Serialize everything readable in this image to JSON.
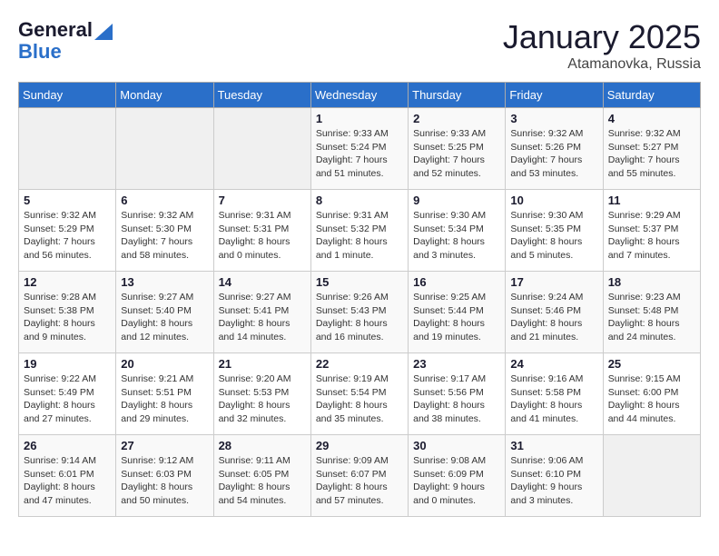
{
  "logo": {
    "general": "General",
    "blue": "Blue"
  },
  "header": {
    "month": "January 2025",
    "location": "Atamanovka, Russia"
  },
  "weekdays": [
    "Sunday",
    "Monday",
    "Tuesday",
    "Wednesday",
    "Thursday",
    "Friday",
    "Saturday"
  ],
  "weeks": [
    [
      {
        "day": "",
        "sunrise": "",
        "sunset": "",
        "daylight": ""
      },
      {
        "day": "",
        "sunrise": "",
        "sunset": "",
        "daylight": ""
      },
      {
        "day": "",
        "sunrise": "",
        "sunset": "",
        "daylight": ""
      },
      {
        "day": "1",
        "sunrise": "Sunrise: 9:33 AM",
        "sunset": "Sunset: 5:24 PM",
        "daylight": "Daylight: 7 hours and 51 minutes."
      },
      {
        "day": "2",
        "sunrise": "Sunrise: 9:33 AM",
        "sunset": "Sunset: 5:25 PM",
        "daylight": "Daylight: 7 hours and 52 minutes."
      },
      {
        "day": "3",
        "sunrise": "Sunrise: 9:32 AM",
        "sunset": "Sunset: 5:26 PM",
        "daylight": "Daylight: 7 hours and 53 minutes."
      },
      {
        "day": "4",
        "sunrise": "Sunrise: 9:32 AM",
        "sunset": "Sunset: 5:27 PM",
        "daylight": "Daylight: 7 hours and 55 minutes."
      }
    ],
    [
      {
        "day": "5",
        "sunrise": "Sunrise: 9:32 AM",
        "sunset": "Sunset: 5:29 PM",
        "daylight": "Daylight: 7 hours and 56 minutes."
      },
      {
        "day": "6",
        "sunrise": "Sunrise: 9:32 AM",
        "sunset": "Sunset: 5:30 PM",
        "daylight": "Daylight: 7 hours and 58 minutes."
      },
      {
        "day": "7",
        "sunrise": "Sunrise: 9:31 AM",
        "sunset": "Sunset: 5:31 PM",
        "daylight": "Daylight: 8 hours and 0 minutes."
      },
      {
        "day": "8",
        "sunrise": "Sunrise: 9:31 AM",
        "sunset": "Sunset: 5:32 PM",
        "daylight": "Daylight: 8 hours and 1 minute."
      },
      {
        "day": "9",
        "sunrise": "Sunrise: 9:30 AM",
        "sunset": "Sunset: 5:34 PM",
        "daylight": "Daylight: 8 hours and 3 minutes."
      },
      {
        "day": "10",
        "sunrise": "Sunrise: 9:30 AM",
        "sunset": "Sunset: 5:35 PM",
        "daylight": "Daylight: 8 hours and 5 minutes."
      },
      {
        "day": "11",
        "sunrise": "Sunrise: 9:29 AM",
        "sunset": "Sunset: 5:37 PM",
        "daylight": "Daylight: 8 hours and 7 minutes."
      }
    ],
    [
      {
        "day": "12",
        "sunrise": "Sunrise: 9:28 AM",
        "sunset": "Sunset: 5:38 PM",
        "daylight": "Daylight: 8 hours and 9 minutes."
      },
      {
        "day": "13",
        "sunrise": "Sunrise: 9:27 AM",
        "sunset": "Sunset: 5:40 PM",
        "daylight": "Daylight: 8 hours and 12 minutes."
      },
      {
        "day": "14",
        "sunrise": "Sunrise: 9:27 AM",
        "sunset": "Sunset: 5:41 PM",
        "daylight": "Daylight: 8 hours and 14 minutes."
      },
      {
        "day": "15",
        "sunrise": "Sunrise: 9:26 AM",
        "sunset": "Sunset: 5:43 PM",
        "daylight": "Daylight: 8 hours and 16 minutes."
      },
      {
        "day": "16",
        "sunrise": "Sunrise: 9:25 AM",
        "sunset": "Sunset: 5:44 PM",
        "daylight": "Daylight: 8 hours and 19 minutes."
      },
      {
        "day": "17",
        "sunrise": "Sunrise: 9:24 AM",
        "sunset": "Sunset: 5:46 PM",
        "daylight": "Daylight: 8 hours and 21 minutes."
      },
      {
        "day": "18",
        "sunrise": "Sunrise: 9:23 AM",
        "sunset": "Sunset: 5:48 PM",
        "daylight": "Daylight: 8 hours and 24 minutes."
      }
    ],
    [
      {
        "day": "19",
        "sunrise": "Sunrise: 9:22 AM",
        "sunset": "Sunset: 5:49 PM",
        "daylight": "Daylight: 8 hours and 27 minutes."
      },
      {
        "day": "20",
        "sunrise": "Sunrise: 9:21 AM",
        "sunset": "Sunset: 5:51 PM",
        "daylight": "Daylight: 8 hours and 29 minutes."
      },
      {
        "day": "21",
        "sunrise": "Sunrise: 9:20 AM",
        "sunset": "Sunset: 5:53 PM",
        "daylight": "Daylight: 8 hours and 32 minutes."
      },
      {
        "day": "22",
        "sunrise": "Sunrise: 9:19 AM",
        "sunset": "Sunset: 5:54 PM",
        "daylight": "Daylight: 8 hours and 35 minutes."
      },
      {
        "day": "23",
        "sunrise": "Sunrise: 9:17 AM",
        "sunset": "Sunset: 5:56 PM",
        "daylight": "Daylight: 8 hours and 38 minutes."
      },
      {
        "day": "24",
        "sunrise": "Sunrise: 9:16 AM",
        "sunset": "Sunset: 5:58 PM",
        "daylight": "Daylight: 8 hours and 41 minutes."
      },
      {
        "day": "25",
        "sunrise": "Sunrise: 9:15 AM",
        "sunset": "Sunset: 6:00 PM",
        "daylight": "Daylight: 8 hours and 44 minutes."
      }
    ],
    [
      {
        "day": "26",
        "sunrise": "Sunrise: 9:14 AM",
        "sunset": "Sunset: 6:01 PM",
        "daylight": "Daylight: 8 hours and 47 minutes."
      },
      {
        "day": "27",
        "sunrise": "Sunrise: 9:12 AM",
        "sunset": "Sunset: 6:03 PM",
        "daylight": "Daylight: 8 hours and 50 minutes."
      },
      {
        "day": "28",
        "sunrise": "Sunrise: 9:11 AM",
        "sunset": "Sunset: 6:05 PM",
        "daylight": "Daylight: 8 hours and 54 minutes."
      },
      {
        "day": "29",
        "sunrise": "Sunrise: 9:09 AM",
        "sunset": "Sunset: 6:07 PM",
        "daylight": "Daylight: 8 hours and 57 minutes."
      },
      {
        "day": "30",
        "sunrise": "Sunrise: 9:08 AM",
        "sunset": "Sunset: 6:09 PM",
        "daylight": "Daylight: 9 hours and 0 minutes."
      },
      {
        "day": "31",
        "sunrise": "Sunrise: 9:06 AM",
        "sunset": "Sunset: 6:10 PM",
        "daylight": "Daylight: 9 hours and 3 minutes."
      },
      {
        "day": "",
        "sunrise": "",
        "sunset": "",
        "daylight": ""
      }
    ]
  ]
}
